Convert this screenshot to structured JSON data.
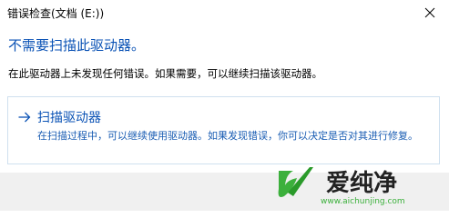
{
  "window": {
    "title": "错误检查(文档 (E:))",
    "close_icon": "close-icon"
  },
  "main": {
    "heading": "不需要扫描此驱动器。",
    "description": "在此驱动器上未发现任何错误。如果需要，可以继续扫描该驱动器。"
  },
  "scan_option": {
    "icon": "arrow-right-icon",
    "title": "扫描驱动器",
    "description": "在扫描过程中，可以继续使用驱动器。如果发现错误，你可以决定是否对其进行修复。"
  },
  "watermark": {
    "brand": "爱纯净",
    "url": "www.aichunjing.com"
  },
  "colors": {
    "accent": "#0a52b5",
    "link_text": "#1a5db3",
    "option_border": "#cfe0ef",
    "footer_bg": "#f0f0f0",
    "watermark_green": "#3cb03c"
  }
}
